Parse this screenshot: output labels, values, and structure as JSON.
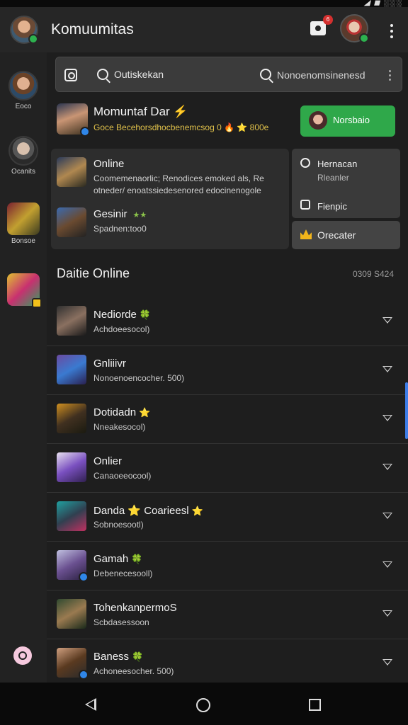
{
  "status_bar": {
    "right_text": "◢ ◼ ░░░"
  },
  "app_bar": {
    "title": "Komuumitas",
    "notification_count": "6"
  },
  "sidebar": {
    "items": [
      {
        "label": "Eoco"
      },
      {
        "label": "Ocanits"
      },
      {
        "label": "Bonsoe"
      },
      {
        "label": ""
      }
    ]
  },
  "search": {
    "query_left": "Outiskekan",
    "query_right": "Nonoenomsinenesd"
  },
  "feature": {
    "name": "Momuntaf Dar ⚡",
    "description": "Goce Becehorsdhocbenemcsog 0 🔥 ⭐ 800e",
    "cta_label": "Norsbaio"
  },
  "cards": [
    {
      "title": "Online",
      "subtitle": "Coomemenaorlic; Renodices emoked als, Re otneder/ enoatssiedesenored edocinenogole",
      "star": ""
    },
    {
      "title": "Gesinir",
      "subtitle": "Spadnen:too0",
      "star": "★★"
    }
  ],
  "popup": {
    "items": [
      {
        "label": "Hernacan"
      },
      {
        "label": "Rleanler"
      },
      {
        "label": "Fienpic"
      }
    ],
    "button_label": "Orecater"
  },
  "section": {
    "title": "Daitie Online",
    "meta": "0309 S424"
  },
  "list": [
    {
      "name": "Nediorde",
      "badge": "🍀",
      "sub": "Achdoeesocol)"
    },
    {
      "name": "Gnliiivr",
      "badge": "",
      "sub": "Nonoenoencocher. 500)"
    },
    {
      "name": "Dotidadn",
      "badge": "⭐",
      "sub": "Nneakesocol)"
    },
    {
      "name": "Onlier",
      "badge": "",
      "sub": "Canaoeeocool)"
    },
    {
      "name": "Danda ⭐ Coarieesl",
      "badge": "⭐",
      "sub": "Sobnoesootl)"
    },
    {
      "name": "Gamah",
      "badge": "🍀",
      "sub": "Debenecesooll)"
    },
    {
      "name": "TohenkanpermoS",
      "badge": "",
      "sub": "Scbdasessoon"
    },
    {
      "name": "Baness",
      "badge": "🍀",
      "sub": "Achoneesocher. 500)"
    }
  ]
}
